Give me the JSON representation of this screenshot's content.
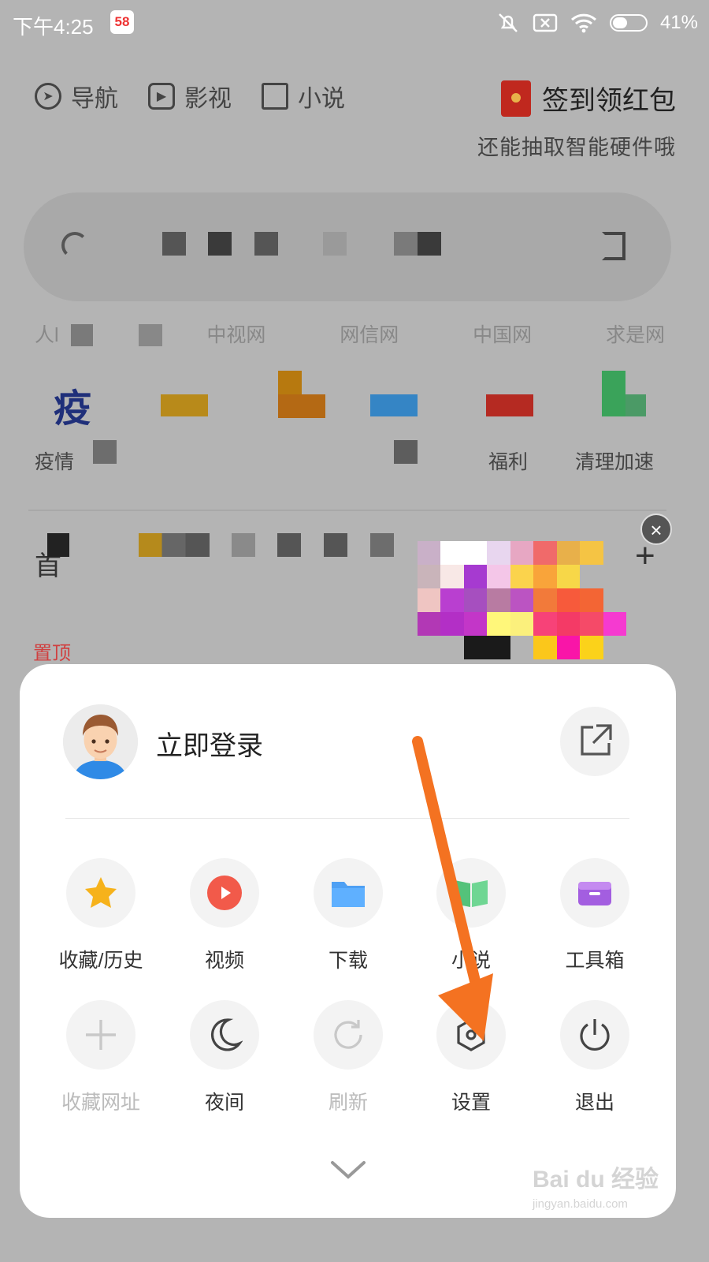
{
  "status_bar": {
    "time": "下午4:25",
    "app_badge": "58",
    "battery": "41%"
  },
  "top_nav": {
    "items": [
      {
        "label": "导航",
        "icon": "compass-icon"
      },
      {
        "label": "影视",
        "icon": "play-square-icon"
      },
      {
        "label": "小说",
        "icon": "book-icon"
      }
    ],
    "promo_title": "签到领红包",
    "promo_subtitle": "还能抽取智能硬件哦"
  },
  "link_row": [
    "人l",
    "",
    "中视网",
    "网信网",
    "中国网",
    "求是网"
  ],
  "quick_labels": [
    "疫情",
    "",
    "",
    "",
    "福利",
    "清理加速"
  ],
  "feed": {
    "tab_char": "首",
    "pinned_label": "置顶"
  },
  "menu": {
    "login_label": "立即登录",
    "rows": [
      [
        {
          "label": "收藏/历史",
          "icon": "star-icon",
          "enabled": true
        },
        {
          "label": "视频",
          "icon": "video-play-icon",
          "enabled": true
        },
        {
          "label": "下载",
          "icon": "folder-icon",
          "enabled": true
        },
        {
          "label": "小说",
          "icon": "book-icon",
          "enabled": true
        },
        {
          "label": "工具箱",
          "icon": "toolbox-icon",
          "enabled": true
        }
      ],
      [
        {
          "label": "收藏网址",
          "icon": "plus-icon",
          "enabled": false
        },
        {
          "label": "夜间",
          "icon": "moon-icon",
          "enabled": true
        },
        {
          "label": "刷新",
          "icon": "refresh-icon",
          "enabled": false
        },
        {
          "label": "设置",
          "icon": "settings-hexagon-icon",
          "enabled": true
        },
        {
          "label": "退出",
          "icon": "power-icon",
          "enabled": true
        }
      ]
    ]
  },
  "watermark": {
    "main": "Bai du 经验",
    "sub": "jingyan.baidu.com"
  },
  "colors": {
    "overlay_gray": "#b4b4b4",
    "arrow": "#f47221",
    "star": "#f6b21b",
    "video": "#f25a4a",
    "folder": "#4ea0f4",
    "book": "#54c27a",
    "toolbox": "#a35ee0"
  }
}
